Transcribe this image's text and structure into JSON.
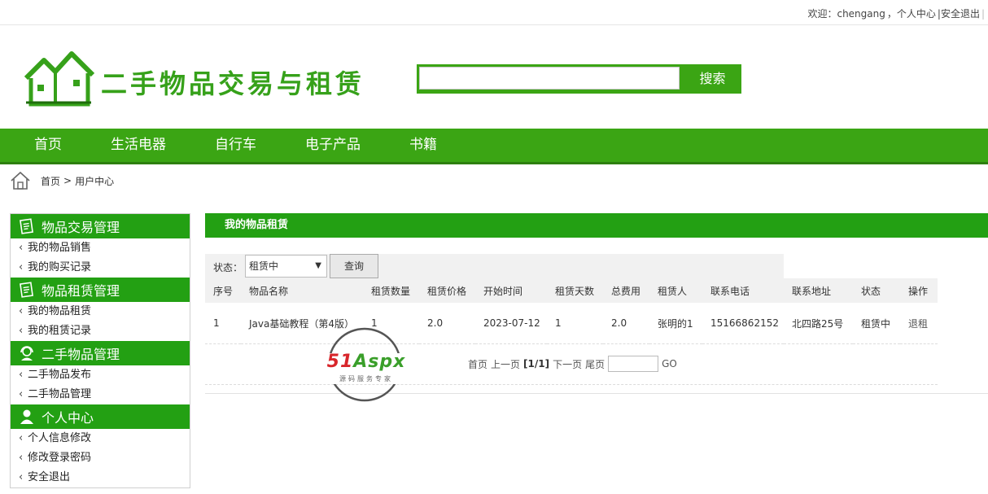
{
  "topbar": {
    "welcome": "欢迎：chengang",
    "sep": "，",
    "user_center": "个人中心",
    "divider": "|",
    "logout": "安全退出",
    "trail": "|"
  },
  "header": {
    "site_title": "二手物品交易与租赁",
    "search_placeholder": "",
    "search_button": "搜索"
  },
  "nav": {
    "items": [
      "首页",
      "生活电器",
      "自行车",
      "电子产品",
      "书籍"
    ]
  },
  "breadcrumb": {
    "home": "首页",
    "sep": ">",
    "current": "用户中心"
  },
  "sidebar": {
    "sections": [
      {
        "title": "物品交易管理",
        "icon": "document-icon",
        "items": [
          "我的物品销售",
          "我的购买记录"
        ]
      },
      {
        "title": "物品租赁管理",
        "icon": "document-icon",
        "items": [
          "我的物品租赁",
          "我的租赁记录"
        ]
      },
      {
        "title": "二手物品管理",
        "icon": "support-agent-icon",
        "items": [
          "二手物品发布",
          "二手物品管理"
        ]
      },
      {
        "title": "个人中心",
        "icon": "user-icon",
        "items": [
          "个人信息修改",
          "修改登录密码",
          "安全退出"
        ]
      }
    ]
  },
  "content": {
    "title": "我的物品租赁",
    "filter_label": "状态：",
    "filter_value": "租赁中",
    "query_button": "查询",
    "columns": [
      "序号",
      "物品名称",
      "租赁数量",
      "租赁价格",
      "开始时间",
      "租赁天数",
      "总费用",
      "租赁人",
      "联系电话",
      "联系地址",
      "状态",
      "操作"
    ],
    "rows": [
      [
        "1",
        "Java基础教程（第4版）",
        "1",
        "2.0",
        "2023-07-12",
        "1",
        "2.0",
        "张明的1",
        "15166862152",
        "北四路25号",
        "租赁中",
        "退租"
      ]
    ]
  },
  "pager": {
    "first": "首页",
    "prev": "上一页",
    "current": "[1/1]",
    "next": "下一页",
    "last": "尾页",
    "go": "GO"
  },
  "watermark": {
    "brand": "51Aspx",
    "tagline": "源码服务专家"
  },
  "colors": {
    "brand_green": "#3ba514",
    "dark_green": "#23a013",
    "text": "#333333"
  }
}
